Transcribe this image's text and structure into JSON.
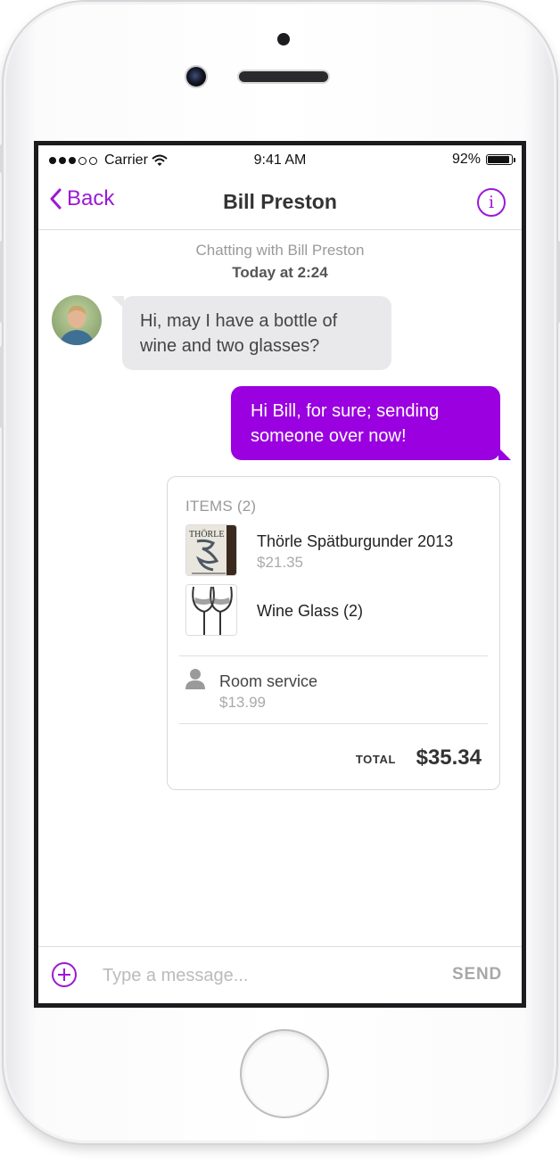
{
  "status_bar": {
    "carrier": "Carrier",
    "time": "9:41 AM",
    "battery": "92%",
    "battery_level": 0.92,
    "signal_icon": "signal-dots-icon",
    "wifi_icon": "wifi-icon",
    "battery_icon": "battery-icon"
  },
  "nav": {
    "back_label": "Back",
    "title": "Bill Preston",
    "info_icon_glyph": "i"
  },
  "chat": {
    "meta": "Chatting with Bill Preston",
    "timestamp": "Today at 2:24",
    "messages": [
      {
        "from": "contact",
        "text": "Hi, may I have a bottle of wine and two glasses?"
      },
      {
        "from": "me",
        "text": "Hi Bill, for sure; sending someone over now!"
      }
    ]
  },
  "order": {
    "items_header": "ITEMS (2)",
    "items": [
      {
        "name": "Thörle Spätburgunder 2013",
        "price": "$21.35",
        "thumb_text": "THÖRLE"
      },
      {
        "name": "Wine Glass (2)",
        "price": ""
      }
    ],
    "service": {
      "name": "Room service",
      "price": "$13.99"
    },
    "total_label": "TOTAL",
    "total_value": "$35.34"
  },
  "composer": {
    "placeholder": "Type a message...",
    "send_label": "SEND"
  },
  "colors": {
    "accent": "#9b19d6",
    "outgoing_bubble": "#9a00e0",
    "incoming_bubble": "#e9e9eb"
  }
}
